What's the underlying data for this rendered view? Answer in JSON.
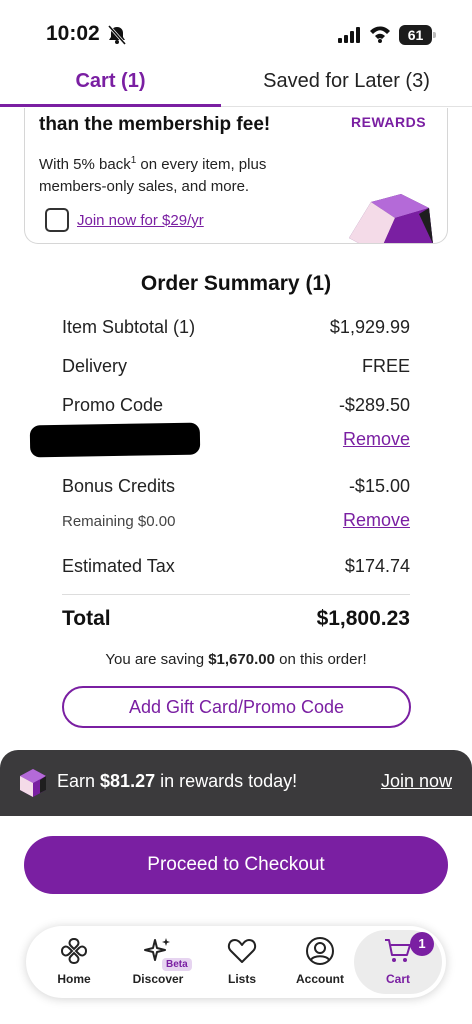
{
  "status_bar": {
    "time": "10:02",
    "battery": "61"
  },
  "tabs": {
    "cart_label": "Cart (1)",
    "saved_label": "Saved for Later (3)"
  },
  "rewards_card": {
    "headline": "than the membership fee!",
    "logo_text": "REWARDS",
    "body_line1": "With 5% back",
    "body_superscript": "1",
    "body_line1_rest": " on every item, plus",
    "body_line2": "members-only sales, and more.",
    "join_label": "Join now for $29/yr"
  },
  "summary": {
    "title": "Order Summary (1)",
    "item_subtotal_label": "Item Subtotal (1)",
    "item_subtotal_value": "$1,929.99",
    "delivery_label": "Delivery",
    "delivery_value": "FREE",
    "promo_label": "Promo Code",
    "promo_value": "-$289.50",
    "promo_remove": "Remove",
    "bonus_label": "Bonus Credits",
    "bonus_value": "-$15.00",
    "bonus_remaining": "Remaining $0.00",
    "bonus_remove": "Remove",
    "tax_label": "Estimated Tax",
    "tax_value": "$174.74",
    "total_label": "Total",
    "total_value": "$1,800.23",
    "saving_prefix": "You are saving ",
    "saving_amount": "$1,670.00",
    "saving_suffix": " on this order!",
    "promo_button": "Add Gift Card/Promo Code"
  },
  "earn_banner": {
    "prefix": "Earn ",
    "amount": "$81.27",
    "suffix": " in rewards today!",
    "join_label": "Join now"
  },
  "checkout_label": "Proceed to Checkout",
  "bottom_nav": {
    "home": "Home",
    "discover": "Discover",
    "discover_badge": "Beta",
    "lists": "Lists",
    "account": "Account",
    "cart": "Cart",
    "cart_count": "1"
  },
  "colors": {
    "accent": "#7a1fa2",
    "banner": "#3b3a3c"
  }
}
